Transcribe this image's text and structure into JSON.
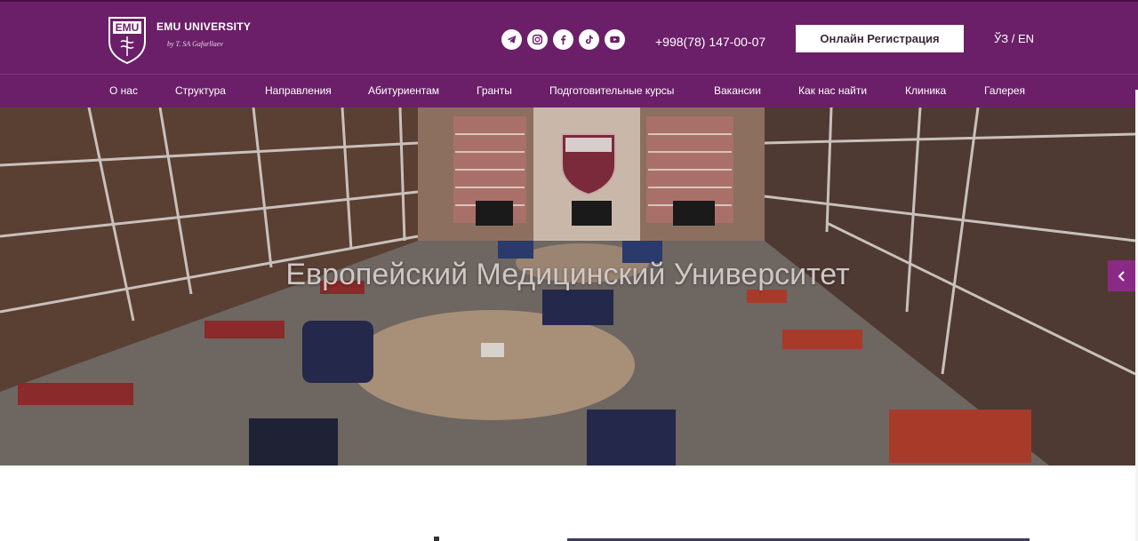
{
  "brand": {
    "logo_letters": "EMU",
    "title": "EMU UNIVERSITY",
    "signature": "by T. SA Gafurllaev"
  },
  "header": {
    "socials": [
      {
        "icon": "telegram-icon"
      },
      {
        "icon": "instagram-icon"
      },
      {
        "icon": "facebook-icon"
      },
      {
        "icon": "tiktok-icon"
      },
      {
        "icon": "youtube-icon"
      }
    ],
    "phone": "+998(78) 147-00-07",
    "register_label": "Онлайн Регистрация",
    "language": "ЎЗ / EN"
  },
  "nav": {
    "items": [
      {
        "label": "О нас"
      },
      {
        "label": "Структура"
      },
      {
        "label": "Направления"
      },
      {
        "label": "Абитуриентам"
      },
      {
        "label": "Гранты"
      },
      {
        "label": "Подготовительные курсы"
      },
      {
        "label": "Вакансии"
      },
      {
        "label": "Как нас найти"
      },
      {
        "label": "Клиника"
      },
      {
        "label": "Галерея"
      }
    ]
  },
  "hero": {
    "title": "Европейский Медицинский Университет"
  },
  "colors": {
    "brand_purple": "#6b1f68",
    "side_tab": "#8b2a86",
    "button_bg": "#ffffff"
  }
}
